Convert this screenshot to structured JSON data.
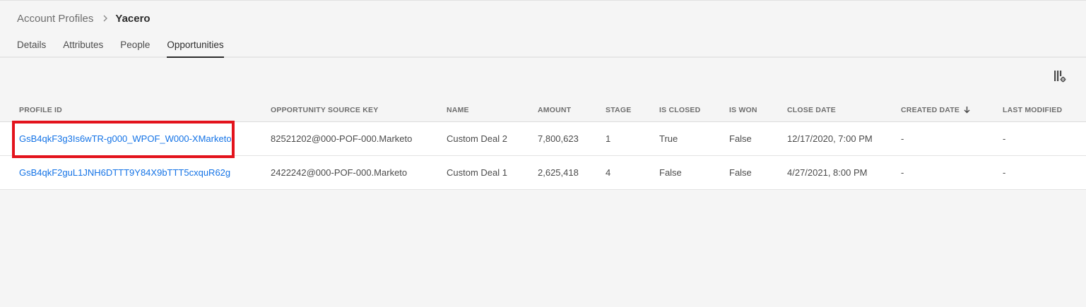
{
  "breadcrumb": {
    "parent": "Account Profiles",
    "current": "Yacero"
  },
  "tabs": [
    "Details",
    "Attributes",
    "People",
    "Opportunities"
  ],
  "active_tab": "Opportunities",
  "table": {
    "columns": [
      "PROFILE ID",
      "OPPORTUNITY SOURCE KEY",
      "NAME",
      "AMOUNT",
      "STAGE",
      "IS CLOSED",
      "IS WON",
      "CLOSE DATE",
      "CREATED DATE",
      "LAST MODIFIED"
    ],
    "sorted_column": "CREATED DATE",
    "sort_direction": "descending",
    "rows": [
      {
        "profile_id": "GsB4qkF3g3Is6wTR-g000_WPOF_W000-XMarketo",
        "source_key": "82521202@000-POF-000.Marketo",
        "name": "Custom Deal 2",
        "amount": "7,800,623",
        "stage": "1",
        "is_closed": "True",
        "is_won": "False",
        "close_date": "12/17/2020, 7:00 PM",
        "created_date": "-",
        "last_modified": "-"
      },
      {
        "profile_id": "GsB4qkF2guL1JNH6DTTT9Y84X9bTTT5cxquR62g",
        "source_key": "2422242@000-POF-000.Marketo",
        "name": "Custom Deal 1",
        "amount": "2,625,418",
        "stage": "4",
        "is_closed": "False",
        "is_won": "False",
        "close_date": "4/27/2021, 8:00 PM",
        "created_date": "-",
        "last_modified": "-"
      }
    ]
  },
  "highlight": {
    "target": "first-row-profile-id",
    "color": "#e3131c"
  },
  "icons": {
    "breadcrumb_separator": "chevron-right-icon",
    "sort": "arrow-down-icon",
    "column_settings": "column-settings-icon"
  },
  "colors": {
    "link": "#1473e6",
    "background": "#f5f5f5",
    "table_body": "#ffffff"
  }
}
